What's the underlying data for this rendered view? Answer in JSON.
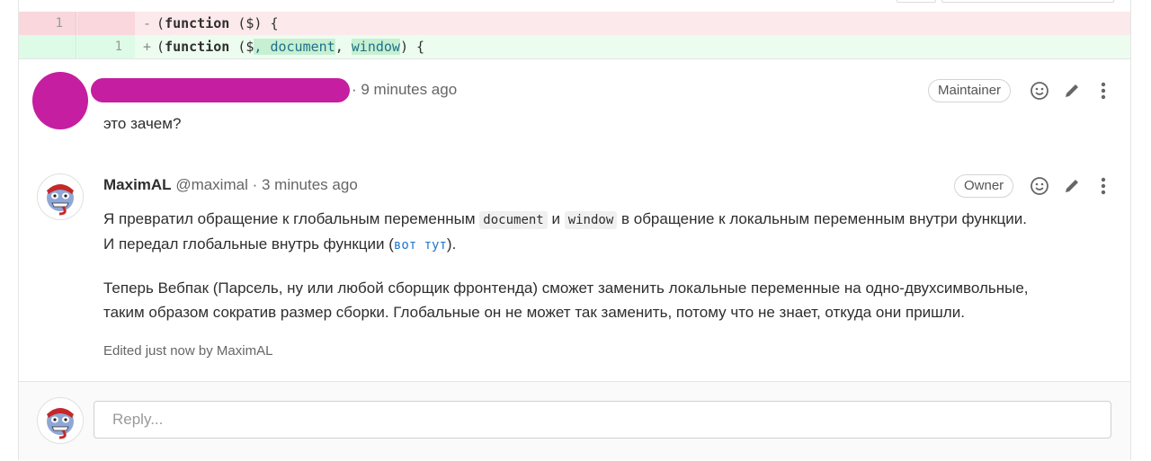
{
  "diff": {
    "old_line": {
      "number": "1",
      "sign": "-",
      "code_pre": "(",
      "keyword": "function",
      "code_post": " ($) {"
    },
    "new_line": {
      "number": "1",
      "sign": "+",
      "code_pre": "(",
      "keyword": "function",
      "code_mid": " ($",
      "hl1": ", document",
      "sep": ", ",
      "hl2": "window",
      "code_post": ") {"
    }
  },
  "comment1": {
    "timestamp": "· 9 minutes ago",
    "role_badge": "Maintainer",
    "text": "это зачем?"
  },
  "comment2": {
    "author_name": "MaximAL",
    "author_handle": "@maximal",
    "timestamp": "· 3 minutes ago",
    "role_badge": "Owner",
    "p1_a": "Я превратил обращение к глобальным переменным ",
    "p1_code1": "document",
    "p1_b": " и ",
    "p1_code2": "window",
    "p1_c": " в обращение к локальным переменным внутри функции.",
    "p2_a": "И передал глобальные внутрь функции (",
    "p2_link": "вот тут",
    "p2_b": ").",
    "p3": "Теперь Вебпак (Парсель, ну или любой сборщик фронтенда) сможет заменить локальные переменные на одно-двухсимвольные,",
    "p4": "таким образом сократив размер сборки. Глобальные он не может так заменить, потому что не знает, откуда они пришли.",
    "edited": "Edited just now by MaximAL"
  },
  "reply": {
    "placeholder": "Reply..."
  },
  "icons": {
    "emoji": "smiley-icon",
    "edit": "pencil-icon",
    "more": "kebab-icon"
  },
  "colors": {
    "redaction": "#c51ea0",
    "old_bg": "#fbe9eb",
    "new_bg": "#ecfdf0",
    "link": "#1f75cb"
  }
}
